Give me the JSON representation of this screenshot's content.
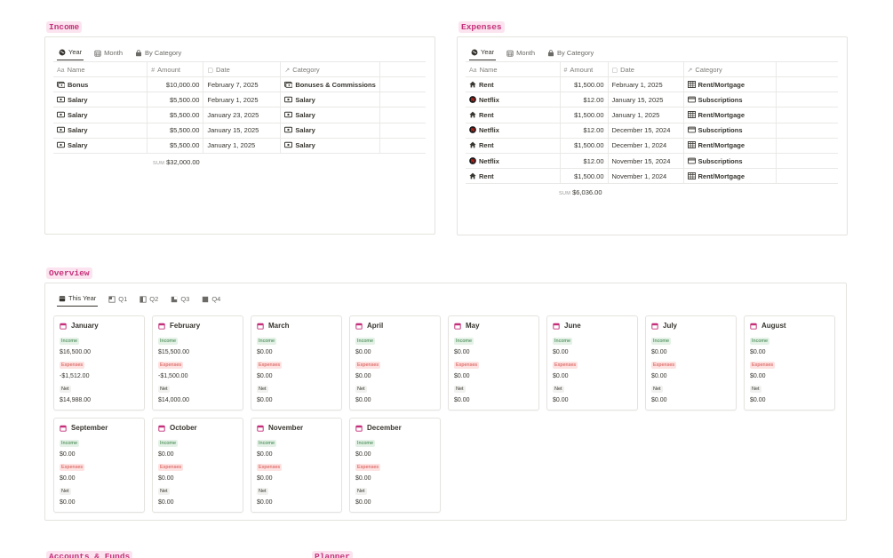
{
  "income": {
    "label": "Income",
    "tabs": [
      {
        "label": "Year",
        "icon": "globe-icon"
      },
      {
        "label": "Month",
        "icon": "calendar-icon"
      },
      {
        "label": "By Category",
        "icon": "bag-icon"
      }
    ],
    "columns": {
      "name": "Name",
      "amount": "Amount",
      "date": "Date",
      "category": "Category"
    },
    "rows": [
      {
        "name": "Bonus",
        "amount": "$10,000.00",
        "date": "February 7, 2025",
        "category": "Bonuses & Commissions"
      },
      {
        "name": "Salary",
        "amount": "$5,500.00",
        "date": "February 1, 2025",
        "category": "Salary"
      },
      {
        "name": "Salary",
        "amount": "$5,500.00",
        "date": "January 23, 2025",
        "category": "Salary"
      },
      {
        "name": "Salary",
        "amount": "$5,500.00",
        "date": "January 15, 2025",
        "category": "Salary"
      },
      {
        "name": "Salary",
        "amount": "$5,500.00",
        "date": "January 1, 2025",
        "category": "Salary"
      }
    ],
    "sum_label": "SUM",
    "sum_value": "$32,000.00"
  },
  "expenses": {
    "label": "Expenses",
    "tabs": [
      {
        "label": "Year",
        "icon": "globe-icon"
      },
      {
        "label": "Month",
        "icon": "calendar-icon"
      },
      {
        "label": "By Category",
        "icon": "bag-icon"
      }
    ],
    "columns": {
      "name": "Name",
      "amount": "Amount",
      "date": "Date",
      "category": "Category"
    },
    "rows": [
      {
        "name": "Rent",
        "amount": "$1,500.00",
        "date": "February 1, 2025",
        "category": "Rent/Mortgage"
      },
      {
        "name": "Netflix",
        "amount": "$12.00",
        "date": "January 15, 2025",
        "category": "Subscriptions"
      },
      {
        "name": "Rent",
        "amount": "$1,500.00",
        "date": "January 1, 2025",
        "category": "Rent/Mortgage"
      },
      {
        "name": "Netflix",
        "amount": "$12.00",
        "date": "December 15, 2024",
        "category": "Subscriptions"
      },
      {
        "name": "Rent",
        "amount": "$1,500.00",
        "date": "December 1, 2024",
        "category": "Rent/Mortgage"
      },
      {
        "name": "Netflix",
        "amount": "$12.00",
        "date": "November 15, 2024",
        "category": "Subscriptions"
      },
      {
        "name": "Rent",
        "amount": "$1,500.00",
        "date": "November 1, 2024",
        "category": "Rent/Mortgage"
      }
    ],
    "sum_label": "SUM",
    "sum_value": "$6,036.00"
  },
  "overview": {
    "label": "Overview",
    "tabs": [
      {
        "label": "This Year",
        "icon": "calendar-icon"
      },
      {
        "label": "Q1",
        "icon": "quarter-icon"
      },
      {
        "label": "Q2",
        "icon": "quarter-icon"
      },
      {
        "label": "Q3",
        "icon": "quarter-icon"
      },
      {
        "label": "Q4",
        "icon": "quarter-icon"
      }
    ],
    "income_label": "Income",
    "expenses_label": "Expenses",
    "net_label": "Net",
    "months": [
      {
        "name": "January",
        "income": "$16,500.00",
        "expenses": "-$1,512.00",
        "net": "$14,988.00"
      },
      {
        "name": "February",
        "income": "$15,500.00",
        "expenses": "-$1,500.00",
        "net": "$14,000.00"
      },
      {
        "name": "March",
        "income": "$0.00",
        "expenses": "$0.00",
        "net": "$0.00"
      },
      {
        "name": "April",
        "income": "$0.00",
        "expenses": "$0.00",
        "net": "$0.00"
      },
      {
        "name": "May",
        "income": "$0.00",
        "expenses": "$0.00",
        "net": "$0.00"
      },
      {
        "name": "June",
        "income": "$0.00",
        "expenses": "$0.00",
        "net": "$0.00"
      },
      {
        "name": "July",
        "income": "$0.00",
        "expenses": "$0.00",
        "net": "$0.00"
      },
      {
        "name": "August",
        "income": "$0.00",
        "expenses": "$0.00",
        "net": "$0.00"
      },
      {
        "name": "September",
        "income": "$0.00",
        "expenses": "$0.00",
        "net": "$0.00"
      },
      {
        "name": "October",
        "income": "$0.00",
        "expenses": "$0.00",
        "net": "$0.00"
      },
      {
        "name": "November",
        "income": "$0.00",
        "expenses": "$0.00",
        "net": "$0.00"
      },
      {
        "name": "December",
        "income": "$0.00",
        "expenses": "$0.00",
        "net": "$0.00"
      }
    ]
  },
  "bottom": {
    "left_label": "Accounts & Funds",
    "right_label": "Planner"
  },
  "colors": {
    "accent": "#c4307a",
    "income_pill": "#e4f1e6",
    "expense_pill": "#fde2e1",
    "netflix": "#d8231a"
  }
}
